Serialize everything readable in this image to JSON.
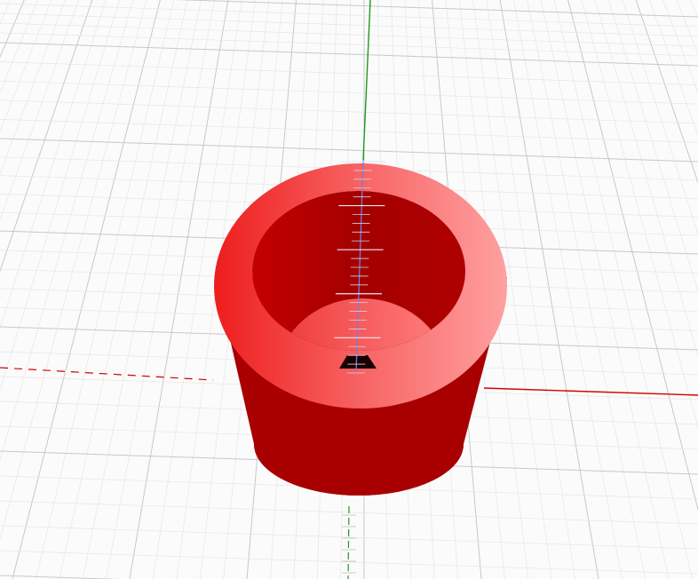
{
  "viewport": {
    "background": "#fbfbfb",
    "grid_major_color": "#c8c8c8",
    "grid_minor_color": "#e6e6e6"
  },
  "axes": {
    "x_color": "#d40000",
    "y_color": "#2aa52a",
    "z_color": "#6b6bcf"
  },
  "model": {
    "shape": "hollow cylinder (cup) with wedge-shaped floor",
    "colors": {
      "outer_wall": "#aa0000",
      "rim_light": "#ff9a9a",
      "rim_dark": "#ee2020",
      "inner_wall": "#a80000",
      "floor": "#f65050"
    }
  }
}
